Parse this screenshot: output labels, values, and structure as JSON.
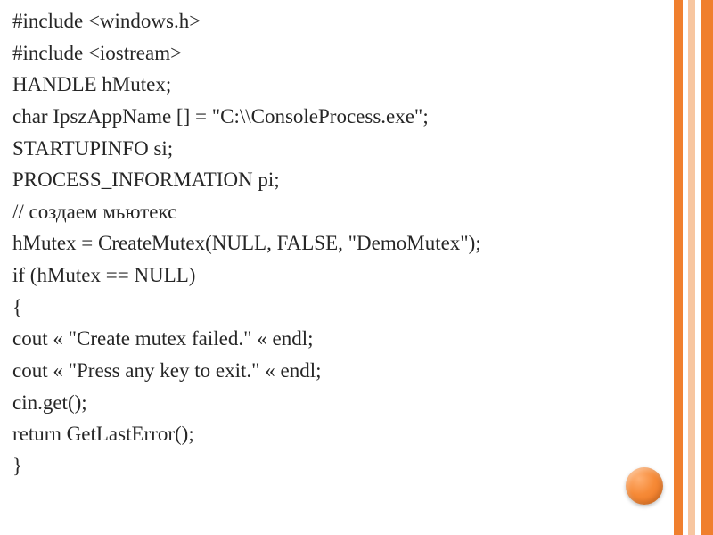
{
  "slide": {
    "code_lines": [
      "#include <windows.h>",
      "#include <iostream>",
      "HANDLE hMutex;",
      "char IpszAppName [] = \"C:\\\\ConsoleProcess.exe\";",
      "STARTUPINFO si;",
      "PROCESS_INFORMATION pi;",
      "// создаем мьютекс",
      "hMutex = CreateMutex(NULL, FALSE, \"DemoMutex\");",
      "if (hMutex == NULL)",
      "{",
      "cout « \"Create mutex failed.\" « endl;",
      "cout « \"Press any key to exit.\" « endl;",
      "cin.get();",
      "return GetLastError();",
      "}"
    ]
  },
  "theme": {
    "accent": "#f07f2e",
    "accent_light": "#f7c6a0",
    "text": "#262626"
  }
}
